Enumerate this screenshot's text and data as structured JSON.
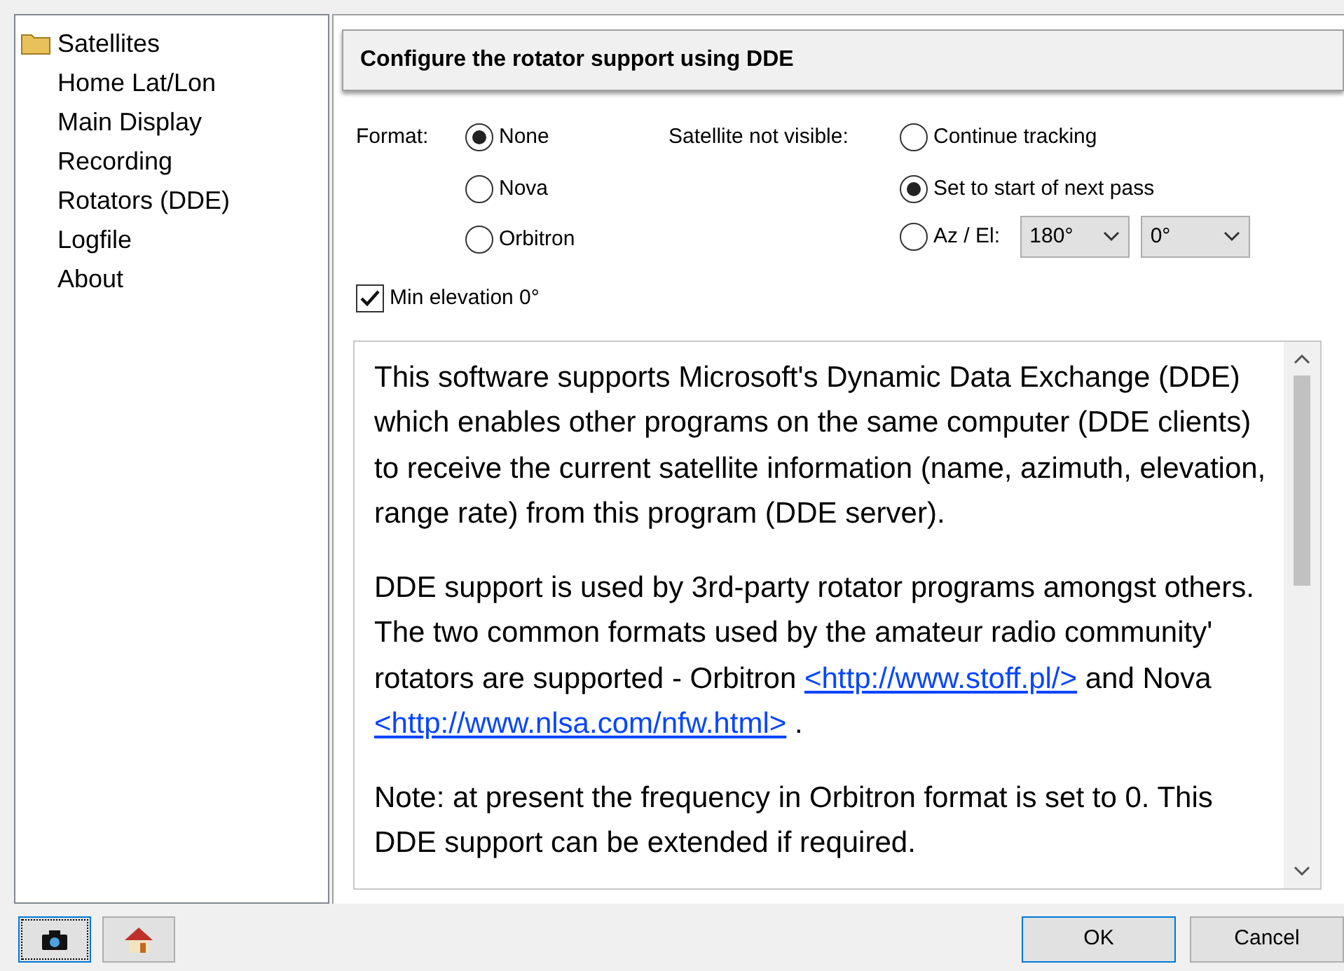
{
  "sidebar": {
    "items": [
      {
        "label": "Satellites",
        "kind": "folder",
        "selected": false
      },
      {
        "label": "Home Lat/Lon",
        "kind": "page",
        "selected": false
      },
      {
        "label": "Main Display",
        "kind": "page",
        "selected": false
      },
      {
        "label": "Recording",
        "kind": "page",
        "selected": false
      },
      {
        "label": "Rotators (DDE)",
        "kind": "page",
        "selected": false
      },
      {
        "label": "Logfile",
        "kind": "page",
        "selected": false
      },
      {
        "label": "About",
        "kind": "page",
        "selected": false
      }
    ]
  },
  "header": {
    "title": "Configure the rotator support using DDE"
  },
  "format": {
    "label": "Format:",
    "options": [
      {
        "label": "None",
        "selected": true
      },
      {
        "label": "Nova",
        "selected": false
      },
      {
        "label": "Orbitron",
        "selected": false
      }
    ]
  },
  "not_visible": {
    "label": "Satellite not visible:",
    "options": [
      {
        "label": "Continue tracking",
        "selected": false
      },
      {
        "label": "Set to start of next pass",
        "selected": true
      },
      {
        "label": "Az / El:",
        "selected": false
      }
    ],
    "azimuth": "180°",
    "elevation": "0°"
  },
  "min_elevation": {
    "label": "Min elevation 0°",
    "checked": true
  },
  "info": {
    "paragraphs": [
      [
        {
          "kind": "text",
          "text": "This software supports Microsoft's Dynamic Data Exchange (DDE) which enables other programs on the same computer (DDE clients) to receive the current satellite information (name, azimuth, elevation, range rate) from this program (DDE server)."
        }
      ],
      [
        {
          "kind": "text",
          "text": "DDE support is used by 3rd-party rotator programs amongst others. The two common formats used by the amateur radio community' rotators are supported - Orbitron "
        },
        {
          "kind": "link",
          "text": "<http://www.stoff.pl/>"
        },
        {
          "kind": "text",
          "text": " and Nova "
        },
        {
          "kind": "link",
          "text": "<http://www.nlsa.com/nfw.html>"
        },
        {
          "kind": "text",
          "text": " ."
        }
      ],
      [
        {
          "kind": "text",
          "text": "Note: at present the frequency in Orbitron format is set to 0. This DDE support can be extended if required."
        }
      ]
    ]
  },
  "buttons": {
    "ok": "OK",
    "cancel": "Cancel"
  }
}
